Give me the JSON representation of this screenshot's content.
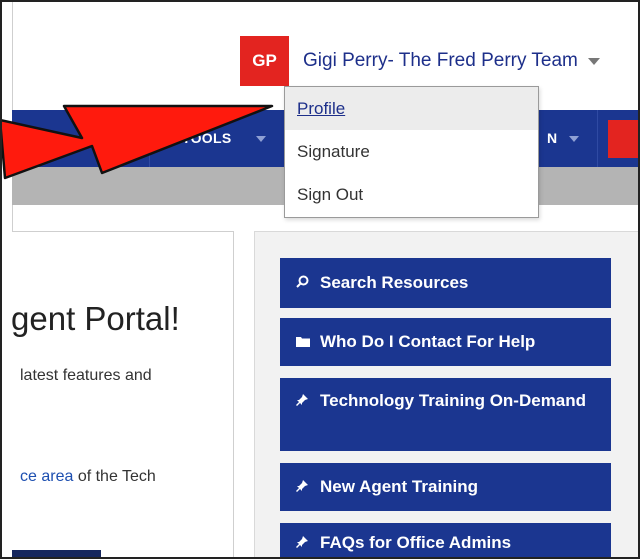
{
  "user": {
    "initials": "GP",
    "name": "Gigi Perry- The Fred Perry Team"
  },
  "nav": {
    "items": [
      {
        "label": "TOOLS"
      },
      {
        "label": "N"
      }
    ]
  },
  "dropdown": {
    "items": [
      {
        "label": "Profile"
      },
      {
        "label": "Signature"
      },
      {
        "label": "Sign Out"
      }
    ]
  },
  "content": {
    "heading": "Agent Portal!",
    "subtext": "latest features and",
    "link_text": "ce area",
    "link_suffix": " of the Tech"
  },
  "resources": [
    {
      "icon": "search-icon",
      "label": "Search Resources"
    },
    {
      "icon": "folder-icon",
      "label": "Who Do I Contact For Help"
    },
    {
      "icon": "pin-icon",
      "label": "Technology Training On-Demand"
    },
    {
      "icon": "pin-icon",
      "label": "New Agent Training"
    },
    {
      "icon": "pin-icon",
      "label": "FAQs for Office Admins"
    }
  ],
  "colors": {
    "brand_blue": "#1b3690",
    "accent_red": "#e32420",
    "arrow_red": "#ff1a0d"
  }
}
